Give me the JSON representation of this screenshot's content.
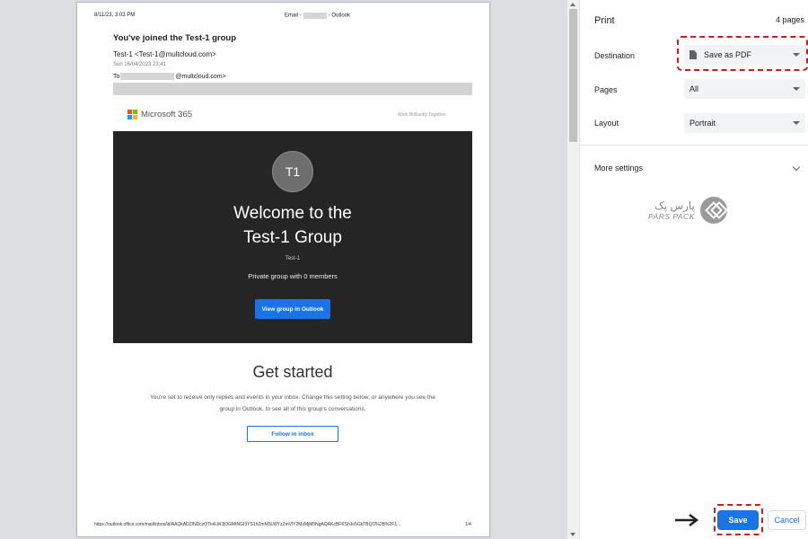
{
  "preview": {
    "header_date": "8/11/23, 3:03 PM",
    "header_title_prefix": "Email -",
    "header_title_suffix": "- Outlook",
    "subject": "You've joined the Test-1 group",
    "from": "Test-1 <Test-1@multcloud.com>",
    "sent_date": "Sun 16/04/2023 23:41",
    "to_prefix": "To",
    "to_suffix": "@multcloud.com>",
    "brand": "Microsoft 365",
    "tagline": "Work Brilliantly Together",
    "avatar_initials": "T1",
    "welcome_line1": "Welcome to the",
    "welcome_line2": "Test-1 Group",
    "group_alias": "Test-1",
    "members_text": "Private group with 0 members",
    "view_button": "View group in Outlook",
    "get_started": "Get started",
    "get_started_body": "You're set to receive only replies and events in your inbox. Change this setting below, or anywhere you see the group in Outlook, to see all of this group's conversations.",
    "follow_button": "Follow in inbox",
    "footer_url": "https://outlook.office.com/mail/inbox/id/AAQkADZlNDczOTk4LWJjOGMtNGI3YS1hZmM3LWYzZmVlY2MxMjM5NgAQAKcBFKShJo5GkTBQO%2B%2F1...",
    "footer_page": "1/4"
  },
  "settings": {
    "title": "Print",
    "page_count": "4 pages",
    "destination_label": "Destination",
    "destination_value": "Save as PDF",
    "pages_label": "Pages",
    "pages_value": "All",
    "layout_label": "Layout",
    "layout_value": "Portrait",
    "more_settings": "More settings",
    "watermark_fa": "پارس پک",
    "watermark_en": "PARS PACK",
    "save_button": "Save",
    "cancel_button": "Cancel"
  },
  "colors": {
    "accent": "#1a73e8",
    "highlight": "#d11a1a",
    "hero_bg": "#252525"
  },
  "icons": [
    "file-icon",
    "caret-down-icon",
    "chevron-down-icon",
    "arrow-right-icon",
    "microsoft-logo-icon",
    "parspack-logo-icon"
  ]
}
